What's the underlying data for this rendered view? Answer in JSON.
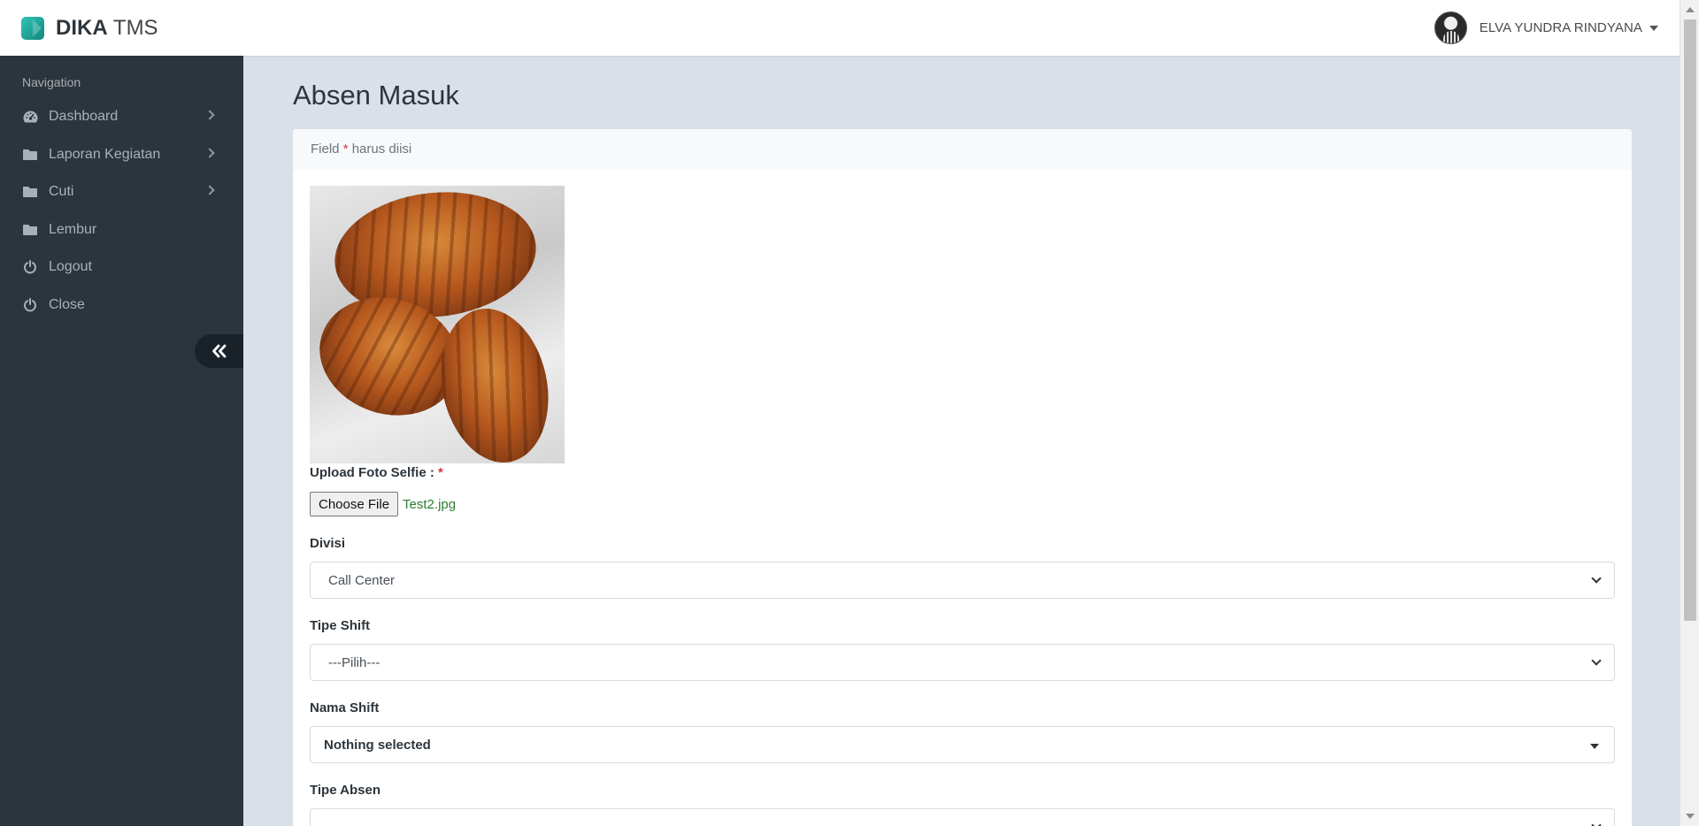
{
  "header": {
    "brand_bold": "DIKA",
    "brand_light": "TMS",
    "user_name": "ELVA YUNDRA RINDYANA"
  },
  "sidebar": {
    "section_label": "Navigation",
    "items": [
      {
        "label": "Dashboard",
        "icon": "gauge-icon",
        "has_submenu": true
      },
      {
        "label": "Laporan Kegiatan",
        "icon": "folder-icon",
        "has_submenu": true
      },
      {
        "label": "Cuti",
        "icon": "folder-icon",
        "has_submenu": true
      },
      {
        "label": "Lembur",
        "icon": "folder-icon",
        "has_submenu": false
      },
      {
        "label": "Logout",
        "icon": "power-icon",
        "has_submenu": false
      },
      {
        "label": "Close",
        "icon": "power-icon",
        "has_submenu": false
      }
    ]
  },
  "page": {
    "title": "Absen Masuk",
    "note_prefix": "Field",
    "note_star": "*",
    "note_suffix": "harus diisi"
  },
  "form": {
    "upload_label": "Upload Foto Selfie :",
    "required_star": "*",
    "file_button": "Choose File",
    "file_name": "Test2.jpg",
    "divisi_label": "Divisi",
    "divisi_value": "Call Center",
    "tipe_shift_label": "Tipe Shift",
    "tipe_shift_value": "---Pilih---",
    "nama_shift_label": "Nama Shift",
    "nama_shift_value": "Nothing selected",
    "tipe_absen_label": "Tipe Absen"
  },
  "colors": {
    "sidebar_bg": "#2d353c",
    "content_bg": "#d9e0e7",
    "brand_accent": "#2ec4b6",
    "required": "#dc3545",
    "file_name": "#2e7d32"
  }
}
